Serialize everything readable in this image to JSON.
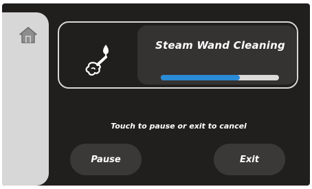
{
  "sidebar": {
    "home_icon": "home-icon"
  },
  "status": {
    "icon": "steam-wand-icon",
    "title": "Steam Wand Cleaning",
    "progress_fraction": 0.67
  },
  "instruction": "Touch to pause or exit to cancel",
  "actions": {
    "pause_label": "Pause",
    "exit_label": "Exit"
  },
  "colors": {
    "background": "#211e1e",
    "sidebar": "#d7d7d7",
    "panel": "#353232",
    "button": "#3b3838",
    "progress": "#2a8bd6",
    "progress_track": "#dcdcdc"
  }
}
